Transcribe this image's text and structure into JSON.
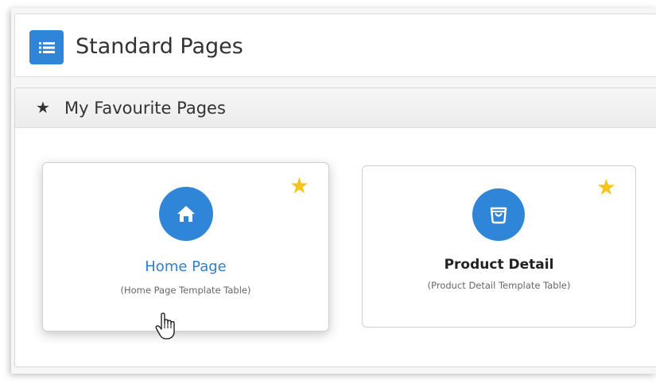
{
  "header": {
    "title": "Standard Pages",
    "icon": "list-icon",
    "accent_color": "#2f86d9"
  },
  "favourites": {
    "title": "My Favourite Pages",
    "icon": "star-icon",
    "cards": [
      {
        "name": "Home Page",
        "subtitle": "(Home Page Template Table)",
        "icon": "home-icon",
        "favourite": true,
        "name_color": "#2f7fd0"
      },
      {
        "name": "Product Detail",
        "subtitle": "(Product Detail Template Table)",
        "icon": "shopping-bag-icon",
        "favourite": true,
        "name_color": "#222222"
      }
    ],
    "star_color": "#f5c518"
  },
  "cursor": {
    "icon": "hand-pointer-icon"
  }
}
